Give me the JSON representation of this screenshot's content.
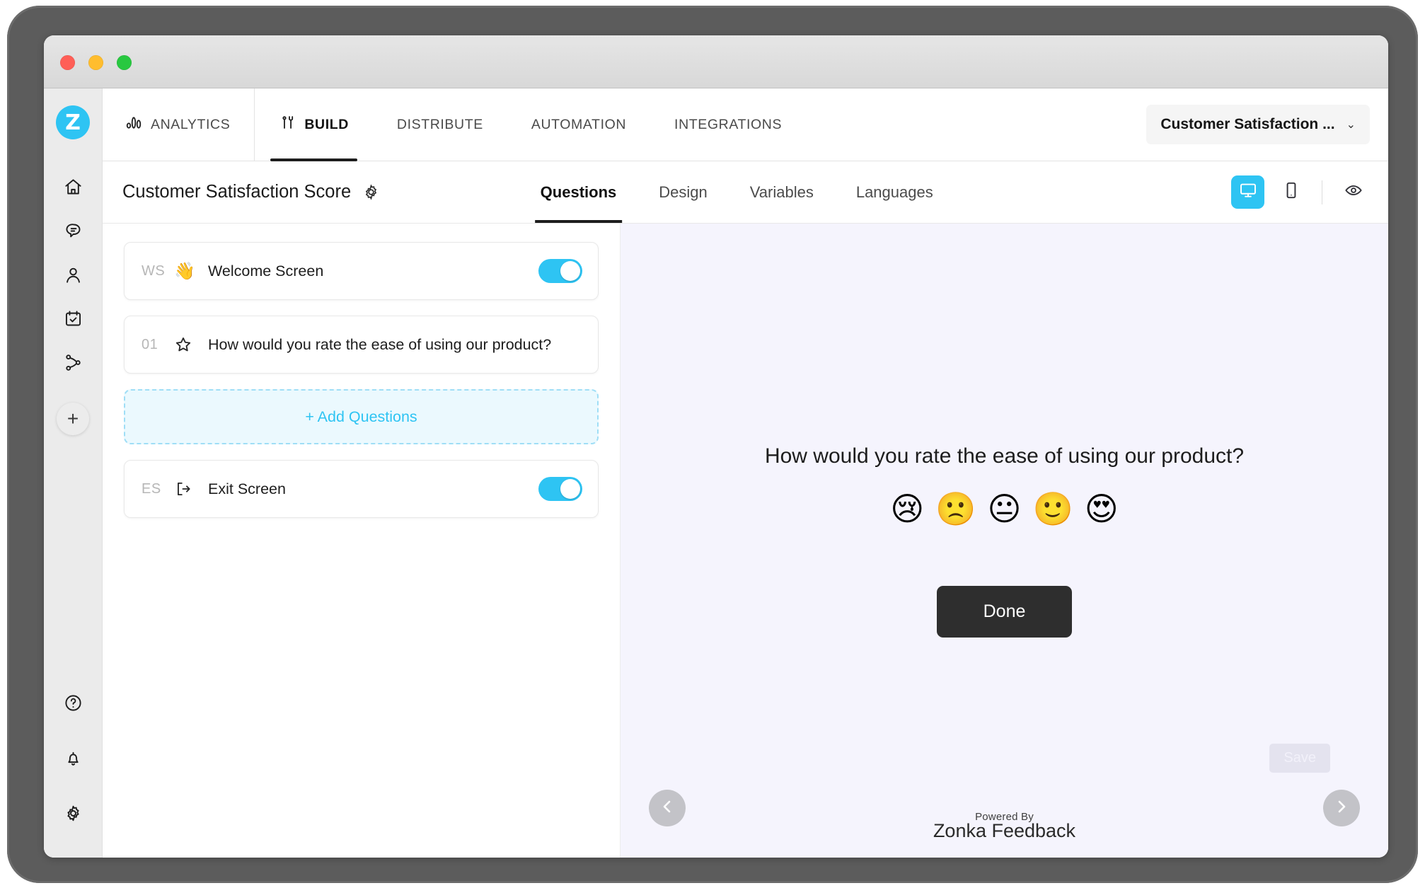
{
  "window": {
    "traffic_lights": [
      "close",
      "minimize",
      "maximize"
    ]
  },
  "sidebar": {
    "logo_letter": "Z",
    "items": [
      {
        "name": "home",
        "icon": "home-icon"
      },
      {
        "name": "inbox",
        "icon": "chat-bubble-icon"
      },
      {
        "name": "contacts",
        "icon": "person-icon"
      },
      {
        "name": "surveys",
        "icon": "calendar-check-icon"
      },
      {
        "name": "workflows",
        "icon": "workflow-icon"
      }
    ],
    "add_label": "+",
    "bottom_items": [
      {
        "name": "help",
        "icon": "question-circle-icon"
      },
      {
        "name": "notifications",
        "icon": "bell-icon"
      },
      {
        "name": "settings",
        "icon": "gear-icon"
      }
    ]
  },
  "topnav": {
    "items": [
      {
        "label": "ANALYTICS",
        "icon": "bar-chart-icon",
        "active": false
      },
      {
        "label": "BUILD",
        "icon": "tools-icon",
        "active": true
      },
      {
        "label": "DISTRIBUTE",
        "icon": "",
        "active": false
      },
      {
        "label": "AUTOMATION",
        "icon": "",
        "active": false
      },
      {
        "label": "INTEGRATIONS",
        "icon": "",
        "active": false
      }
    ],
    "survey_selector": {
      "value": "Customer Satisfaction ...",
      "caret": "⌄"
    }
  },
  "subbar": {
    "survey_title": "Customer Satisfaction Score",
    "tabs": [
      {
        "label": "Questions",
        "active": true
      },
      {
        "label": "Design",
        "active": false
      },
      {
        "label": "Variables",
        "active": false
      },
      {
        "label": "Languages",
        "active": false
      }
    ],
    "view_modes": [
      {
        "name": "desktop",
        "active": true
      },
      {
        "name": "mobile",
        "active": false
      }
    ],
    "preview_label": "preview"
  },
  "questions_panel": {
    "rows": [
      {
        "num": "WS",
        "icon": "wave-hand-emoji",
        "emoji": "👋",
        "label": "Welcome Screen",
        "toggle": true
      },
      {
        "num": "01",
        "icon": "star-icon",
        "emoji": "",
        "label": "How would you rate the ease of using our product?",
        "toggle": false
      }
    ],
    "add_questions_label": "+ Add Questions",
    "exit_row": {
      "num": "ES",
      "icon": "exit-icon",
      "label": "Exit Screen",
      "toggle": true
    }
  },
  "preview": {
    "question_text": "How would you rate the ease of using our product?",
    "rating_emojis": [
      {
        "name": "crying-face",
        "glyph": "😢"
      },
      {
        "name": "frowning-face",
        "glyph": "🙁"
      },
      {
        "name": "neutral-face",
        "glyph": "😐"
      },
      {
        "name": "slightly-smiling-face",
        "glyph": "🙂"
      },
      {
        "name": "heart-eyes-face",
        "glyph": "😍"
      }
    ],
    "done_label": "Done",
    "save_label": "Save",
    "powered_by_small": "Powered By",
    "powered_by_brand": "Zonka Feedback",
    "prev_label": "‹",
    "next_label": "›"
  },
  "colors": {
    "accent": "#2ec4f3",
    "preview_bg": "#f5f4fd",
    "done_btn": "#2e2e2e",
    "rail_bg": "#ebebeb"
  }
}
